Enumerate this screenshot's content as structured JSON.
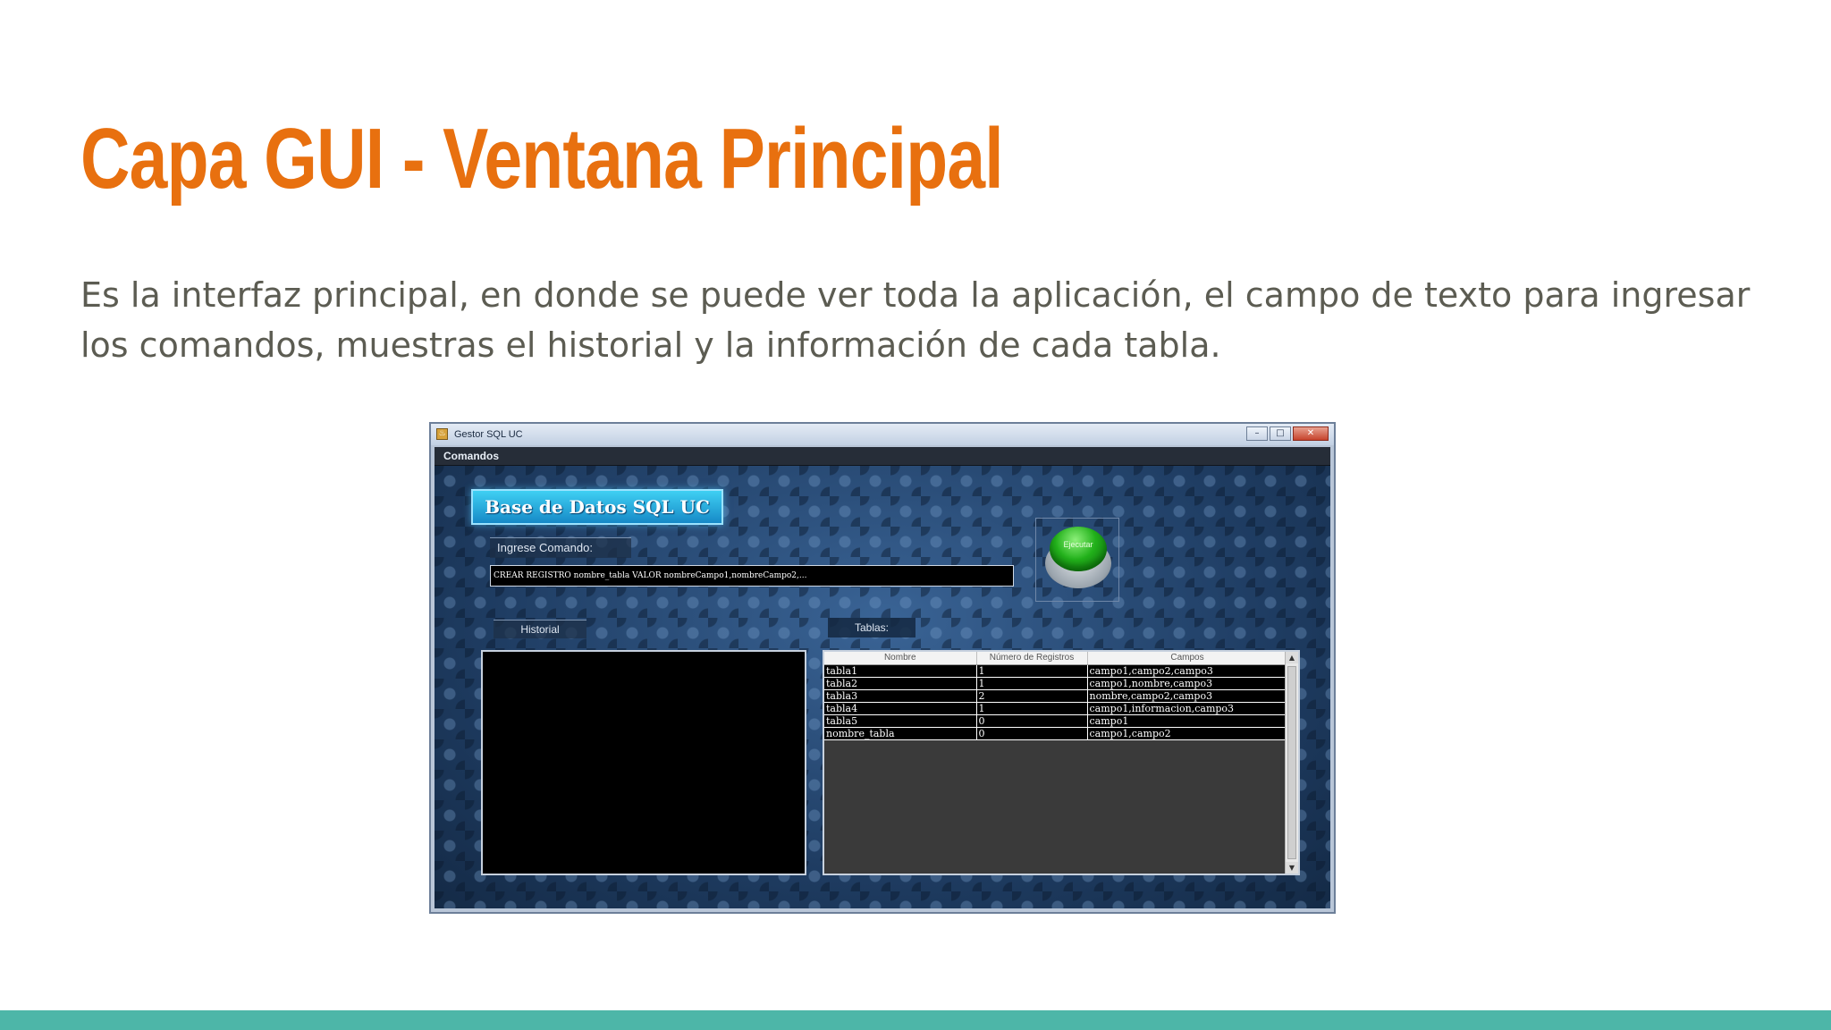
{
  "slide": {
    "title": "Capa GUI - Ventana Principal",
    "text": "Es la interfaz principal, en donde se puede ver toda la aplicación, el campo de texto para ingresar los comandos, muestras el historial y la información de cada tabla.",
    "accent_color": "#e8700f",
    "bar_color": "#4db6a8"
  },
  "app": {
    "window_title": "Gestor SQL UC",
    "menu": [
      "Comandos"
    ],
    "banner": "Base de Datos SQL UC",
    "command_label": "Ingrese Comando:",
    "command_value": "CREAR REGISTRO nombre_tabla VALOR nombreCampo1,nombreCampo2,...",
    "execute_label": "Ejecutar",
    "historial_label": "Historial",
    "tablas_label": "Tablas:",
    "table": {
      "columns": [
        "Nombre",
        "Número de Registros",
        "Campos"
      ],
      "rows": [
        [
          "tabla1",
          "1",
          "campo1,campo2,campo3"
        ],
        [
          "tabla2",
          "1",
          "campo1,nombre,campo3"
        ],
        [
          "tabla3",
          "2",
          "nombre,campo2,campo3"
        ],
        [
          "tabla4",
          "1",
          "campo1,informacion,campo3"
        ],
        [
          "tabla5",
          "0",
          "campo1"
        ],
        [
          "nombre_tabla",
          "0",
          "campo1,campo2"
        ]
      ]
    },
    "icons": {
      "minimize": "minimize-icon",
      "maximize": "maximize-icon",
      "close": "close-icon",
      "scroll_up": "chevron-up-icon",
      "scroll_down": "chevron-down-icon"
    }
  }
}
